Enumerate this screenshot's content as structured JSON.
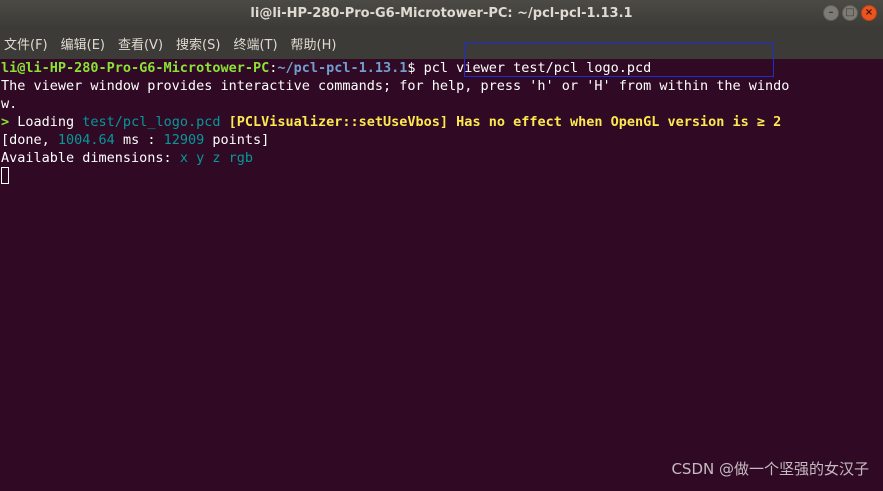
{
  "window": {
    "title": "li@li-HP-280-Pro-G6-Microtower-PC: ~/pcl-pcl-1.13.1",
    "controls": {
      "minimize": "–",
      "maximize": "□",
      "close": "×"
    }
  },
  "menu": {
    "items": [
      {
        "label": "文件(F)"
      },
      {
        "label": "编辑(E)"
      },
      {
        "label": "查看(V)"
      },
      {
        "label": "搜索(S)"
      },
      {
        "label": "终端(T)"
      },
      {
        "label": "帮助(H)"
      }
    ]
  },
  "terminal": {
    "prompt": {
      "user_host": "li@li-HP-280-Pro-G6-Microtower-PC",
      "colon": ":",
      "path": "~/pcl-pcl-1.13.1",
      "symbol": "$ ",
      "command": "pcl viewer test/pcl logo.pcd"
    },
    "help_line_1": "The viewer window provides interactive commands; for help, press 'h' or 'H' from within the windo",
    "help_line_2": "w.",
    "loading": {
      "marker": "> ",
      "text": "Loading ",
      "file": "test/pcl_logo.pcd",
      "space": " ",
      "warning": "[PCLVisualizer::setUseVbos] Has no effect when OpenGL version is ≥ 2"
    },
    "done": {
      "prefix": "[done, ",
      "ms_value": "1004.64",
      "ms_unit": " ms : ",
      "points_value": "12909",
      "points_unit": " points]"
    },
    "dimensions": {
      "label": "Available dimensions: ",
      "value": "x y z rgb"
    }
  },
  "watermark": {
    "text": "CSDN @做一个坚强的女汉子"
  },
  "colors": {
    "terminal_bg": "#300a24",
    "prompt_green": "#8ae234",
    "path_blue": "#729fcf",
    "cyan": "#06989a",
    "yellow": "#fce94f",
    "highlight_box": "#1f2ccf"
  }
}
